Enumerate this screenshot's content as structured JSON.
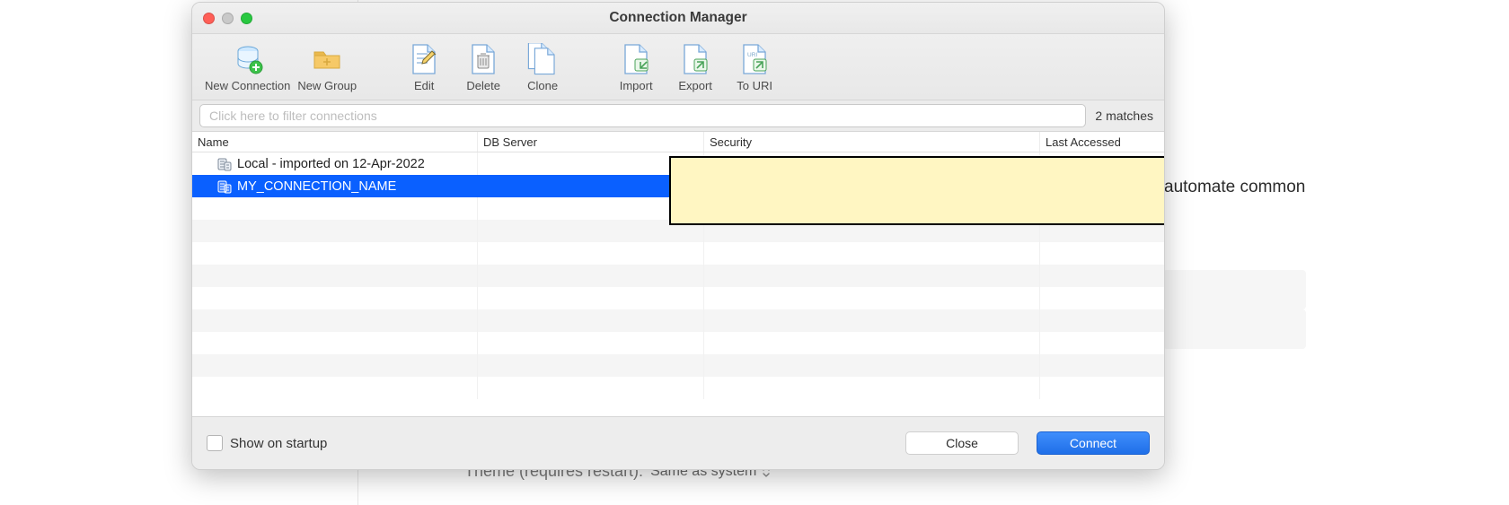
{
  "window": {
    "title": "Connection Manager"
  },
  "toolbar": {
    "new_connection": "New Connection",
    "new_group": "New Group",
    "edit": "Edit",
    "delete": "Delete",
    "clone": "Clone",
    "import": "Import",
    "export": "Export",
    "to_uri": "To URI"
  },
  "filter": {
    "placeholder": "Click here to filter connections",
    "value": "",
    "matches": "2 matches"
  },
  "columns": {
    "name": "Name",
    "db_server": "DB Server",
    "security": "Security",
    "last_accessed": "Last Accessed"
  },
  "rows": [
    {
      "name": "Local - imported on 12-Apr-2022",
      "db_server": "",
      "security": "",
      "last_accessed": "",
      "selected": false
    },
    {
      "name": "MY_CONNECTION_NAME",
      "db_server": "",
      "security": "",
      "last_accessed": "",
      "selected": true
    }
  ],
  "footer": {
    "show_on_startup": "Show on startup",
    "close": "Close",
    "connect": "Connect"
  },
  "background": {
    "right_text": "automate common",
    "bottom_label": "Theme (requires restart):",
    "bottom_value": "Same as system"
  }
}
